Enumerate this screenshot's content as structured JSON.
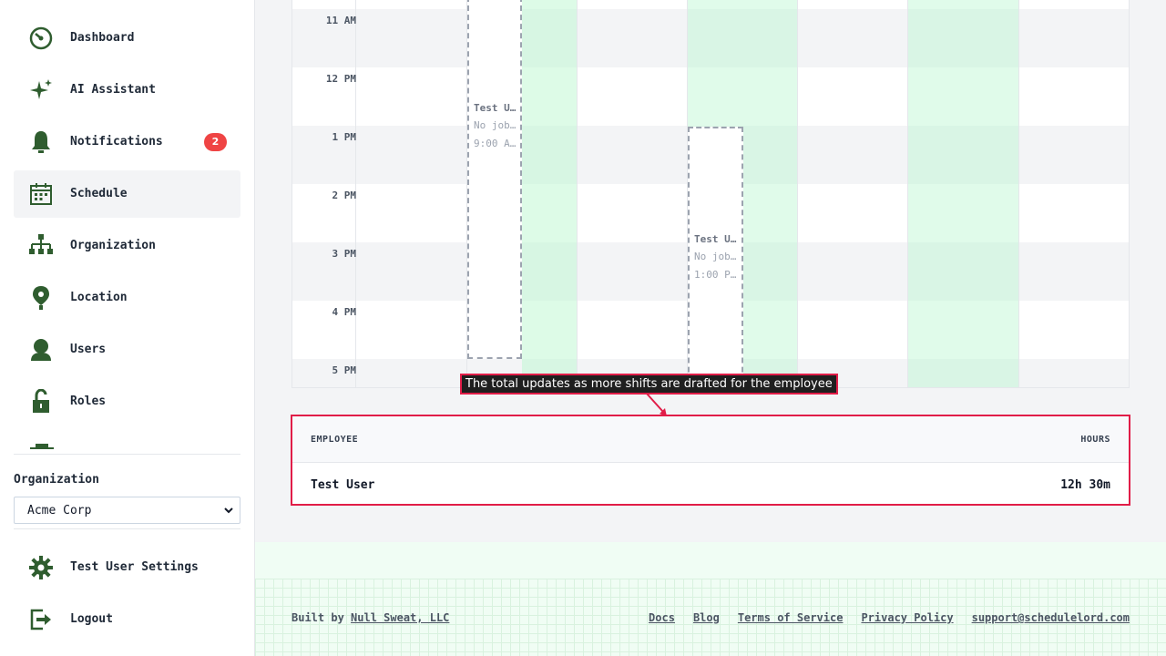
{
  "sidebar": {
    "items": [
      {
        "label": "Dashboard",
        "icon": "dashboard-icon"
      },
      {
        "label": "AI Assistant",
        "icon": "sparkle-icon"
      },
      {
        "label": "Notifications",
        "icon": "bell-icon",
        "badge": "2"
      },
      {
        "label": "Schedule",
        "icon": "calendar-icon",
        "active": true
      },
      {
        "label": "Organization",
        "icon": "org-chart-icon"
      },
      {
        "label": "Location",
        "icon": "location-pin-icon"
      },
      {
        "label": "Users",
        "icon": "user-icon"
      },
      {
        "label": "Roles",
        "icon": "lock-icon"
      }
    ],
    "org_label": "Organization",
    "org_selected": "Acme Corp",
    "settings_label": "Test User Settings",
    "logout_label": "Logout"
  },
  "calendar": {
    "times": [
      "11 AM",
      "12 PM",
      "1 PM",
      "2 PM",
      "3 PM",
      "4 PM",
      "5 PM"
    ],
    "shifts": [
      {
        "name": "Test U…",
        "job": "No job…",
        "time": "9:00 A…"
      },
      {
        "name": "Test U…",
        "job": "No job…",
        "time": "1:00 P…"
      }
    ]
  },
  "callout": {
    "text": "The total updates as more shifts are drafted for the employee"
  },
  "summary": {
    "header_employee": "EMPLOYEE",
    "header_hours": "HOURS",
    "rows": [
      {
        "employee": "Test User",
        "hours": "12h 30m"
      }
    ]
  },
  "footer": {
    "built_prefix": "Built by",
    "built_link": "Null Sweat, LLC",
    "links": [
      "Docs",
      "Blog",
      "Terms of Service",
      "Privacy Policy",
      "support@schedulelord.com"
    ]
  },
  "colors": {
    "accent": "#2f5d2f",
    "badge": "#ef4444",
    "highlight": "#e11d48",
    "green_col": "#dcfce7"
  }
}
